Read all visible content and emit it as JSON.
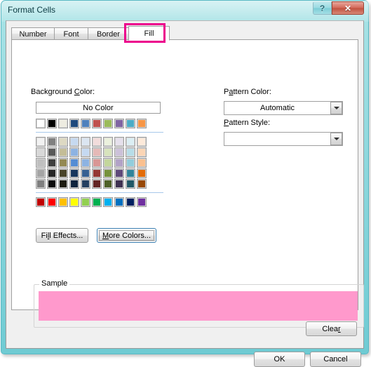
{
  "window": {
    "title": "Format Cells",
    "help_button": "?",
    "close_button": "✕"
  },
  "tabs": [
    {
      "label": "Number",
      "active": false
    },
    {
      "label": "Font",
      "active": false
    },
    {
      "label": "Border",
      "active": false
    },
    {
      "label": "Fill",
      "active": true
    }
  ],
  "highlight": {
    "target": "Fill",
    "color": "#ec008c"
  },
  "background_color": {
    "label_before": "Background ",
    "label_accel": "C",
    "label_after": "olor:",
    "no_color_label": "No Color",
    "theme_colors": [
      "#ffffff",
      "#000000",
      "#eeece1",
      "#1f497d",
      "#4f81bd",
      "#c0504d",
      "#9bbb59",
      "#8064a2",
      "#4bacc6",
      "#f79646"
    ],
    "shade_rows": [
      [
        "#f2f2f2",
        "#808080",
        "#ddd9c3",
        "#c6d9f0",
        "#dbe5f1",
        "#f2dcdb",
        "#ebf1dd",
        "#e5e0ec",
        "#dbeef3",
        "#fdeada"
      ],
      [
        "#d8d8d8",
        "#595959",
        "#c4bd97",
        "#8db3e2",
        "#c5d9f1",
        "#e5b9b7",
        "#d7e3bc",
        "#ccc1d9",
        "#b7dde8",
        "#fbd5b5"
      ],
      [
        "#bfbfbf",
        "#3f3f3f",
        "#938953",
        "#548dd4",
        "#8db3e2",
        "#d99694",
        "#c3d69b",
        "#b2a2c7",
        "#92cddc",
        "#fac08f"
      ],
      [
        "#a5a5a5",
        "#262626",
        "#494429",
        "#17365d",
        "#366092",
        "#953734",
        "#76923c",
        "#5f497a",
        "#31849b",
        "#e36c09"
      ],
      [
        "#7f7f7f",
        "#0c0c0c",
        "#1d1b10",
        "#0f243e",
        "#244061",
        "#632423",
        "#4f6128",
        "#3f3151",
        "#205867",
        "#974806"
      ]
    ],
    "standard_colors": [
      "#c00000",
      "#ff0000",
      "#ffc000",
      "#ffff00",
      "#92d050",
      "#00b050",
      "#00b0f0",
      "#0070c0",
      "#002060",
      "#7030a0"
    ],
    "fill_effects_label_before": "Fi",
    "fill_effects_label_accel": "l",
    "fill_effects_label_after": "l Effects...",
    "more_colors_label_accel": "M",
    "more_colors_label_after": "ore Colors..."
  },
  "pattern_color": {
    "label_accel": "a",
    "label_before": "P",
    "label_after": "ttern Color:",
    "value": "Automatic"
  },
  "pattern_style": {
    "label_accel": "P",
    "label_after": "attern Style:",
    "value": ""
  },
  "sample": {
    "legend": "Sample",
    "fill_color": "#ff99cc"
  },
  "buttons": {
    "clear_before": "Clea",
    "clear_accel": "r",
    "ok": "OK",
    "cancel": "Cancel"
  }
}
